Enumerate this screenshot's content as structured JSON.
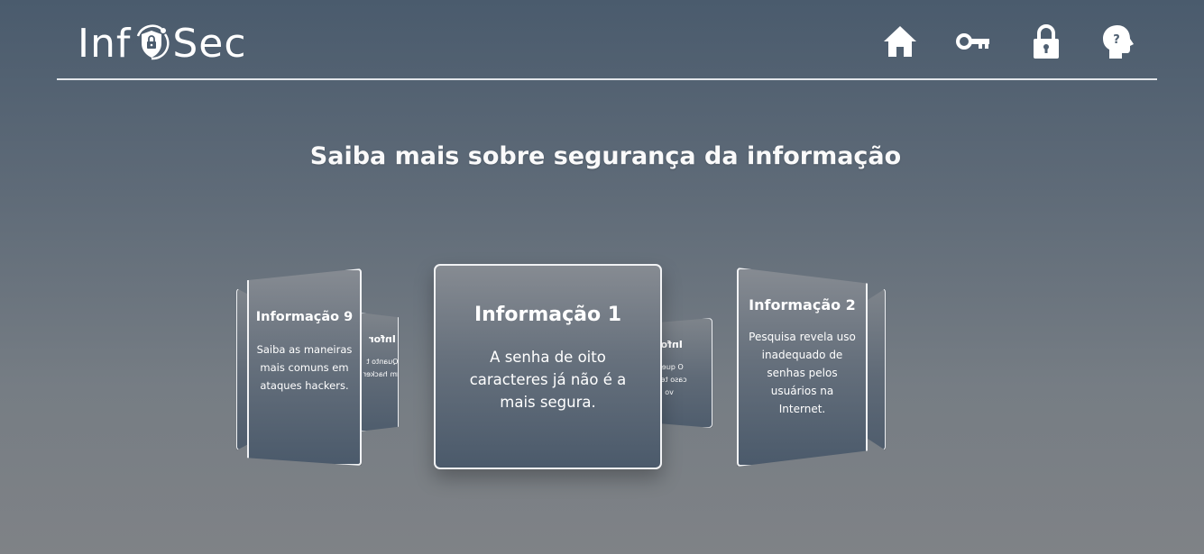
{
  "header": {
    "logo_prefix": "Inf",
    "logo_suffix": "Sec",
    "nav": [
      {
        "icon": "home-icon"
      },
      {
        "icon": "key-icon"
      },
      {
        "icon": "lock-icon"
      },
      {
        "icon": "head-question-icon"
      }
    ]
  },
  "page_title": "Saiba mais sobre segurança da informação",
  "carousel": {
    "active": {
      "title": "Informação 1",
      "text": "A senha de oito caracteres já não é a mais segura."
    },
    "left": {
      "title": "Informação 9",
      "text": "Saiba as maneiras mais comuns em ataques hackers."
    },
    "right": {
      "title": "Informação 2",
      "text": "Pesquisa revela uso inadequado de senhas pelos usuários na Internet."
    },
    "behind_left_fragment": {
      "title": "Infor",
      "line1": "Quanto t",
      "line2": "um hacker"
    },
    "behind_center_fragment": {
      "title": "Infor",
      "line1": "O que d",
      "line2": "caso tenh",
      "line3": "vo"
    }
  },
  "colors": {
    "background_top": "#4a5b6d",
    "background_bottom": "#7f8286",
    "card_border": "#f2f3f5",
    "text": "#ffffff"
  }
}
